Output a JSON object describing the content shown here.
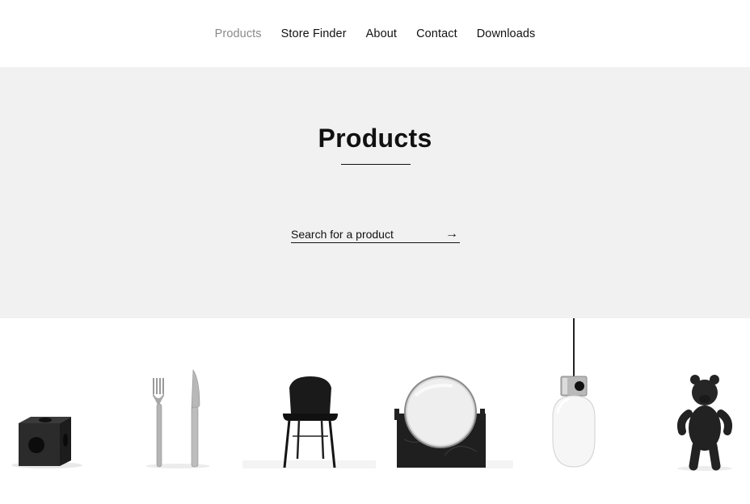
{
  "nav": {
    "items": [
      {
        "label": "Products",
        "active": true
      },
      {
        "label": "Store Finder",
        "active": false
      },
      {
        "label": "About",
        "active": false
      },
      {
        "label": "Contact",
        "active": false
      },
      {
        "label": "Downloads",
        "active": false
      }
    ]
  },
  "hero": {
    "title": "Products",
    "search": {
      "placeholder": "Search for a product",
      "submit_icon": "arrow-right-icon",
      "submit_glyph": "→"
    }
  },
  "products": [
    {
      "name": "cube-candleholder",
      "icon": "cube-icon"
    },
    {
      "name": "cutlery",
      "icon": "fork-knife-icon"
    },
    {
      "name": "chair",
      "icon": "chair-icon"
    },
    {
      "name": "mirror",
      "icon": "mirror-icon"
    },
    {
      "name": "pendant-lamp",
      "icon": "lamp-icon"
    },
    {
      "name": "teddy-bear",
      "icon": "bear-icon"
    }
  ],
  "colors": {
    "hero_bg": "#f1f1f1",
    "active_nav": "#8a8a8a",
    "text": "#111111"
  }
}
